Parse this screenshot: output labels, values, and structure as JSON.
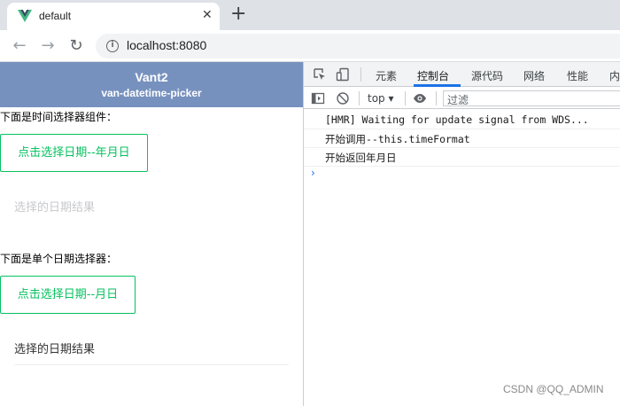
{
  "browser": {
    "tab_title": "default",
    "tab_close": "✕",
    "new_tab": "+",
    "url": "localhost:8080",
    "back": "←",
    "forward": "→",
    "reload": "↻",
    "info": "i"
  },
  "page": {
    "header_title": "Vant2",
    "header_subtitle": "van-datetime-picker",
    "section1_label": "下面是时间选择器组件：",
    "button1_label": "点击选择日期--年月日",
    "result1_text": "选择的日期结果",
    "section2_label": "下面是单个日期选择器：",
    "button2_label": "点击选择日期--月日",
    "result2_text": "选择的日期结果"
  },
  "devtools": {
    "tabs": [
      "元素",
      "控制台",
      "源代码",
      "网络",
      "性能",
      "内"
    ],
    "active_tab": "控制台",
    "context": "top",
    "filter_placeholder": "过滤",
    "logs": [
      "[HMR] Waiting for update signal from WDS...",
      "开始调用--this.timeFormat",
      "开始返回年月日"
    ],
    "prompt": "›"
  },
  "watermark": "CSDN @QQ_ADMIN",
  "colors": {
    "header_bg": "#7791bf",
    "vant_green": "#07c160",
    "devtools_accent": "#1a73e8",
    "vue_green": "#41b883",
    "vue_dark": "#34495e"
  }
}
